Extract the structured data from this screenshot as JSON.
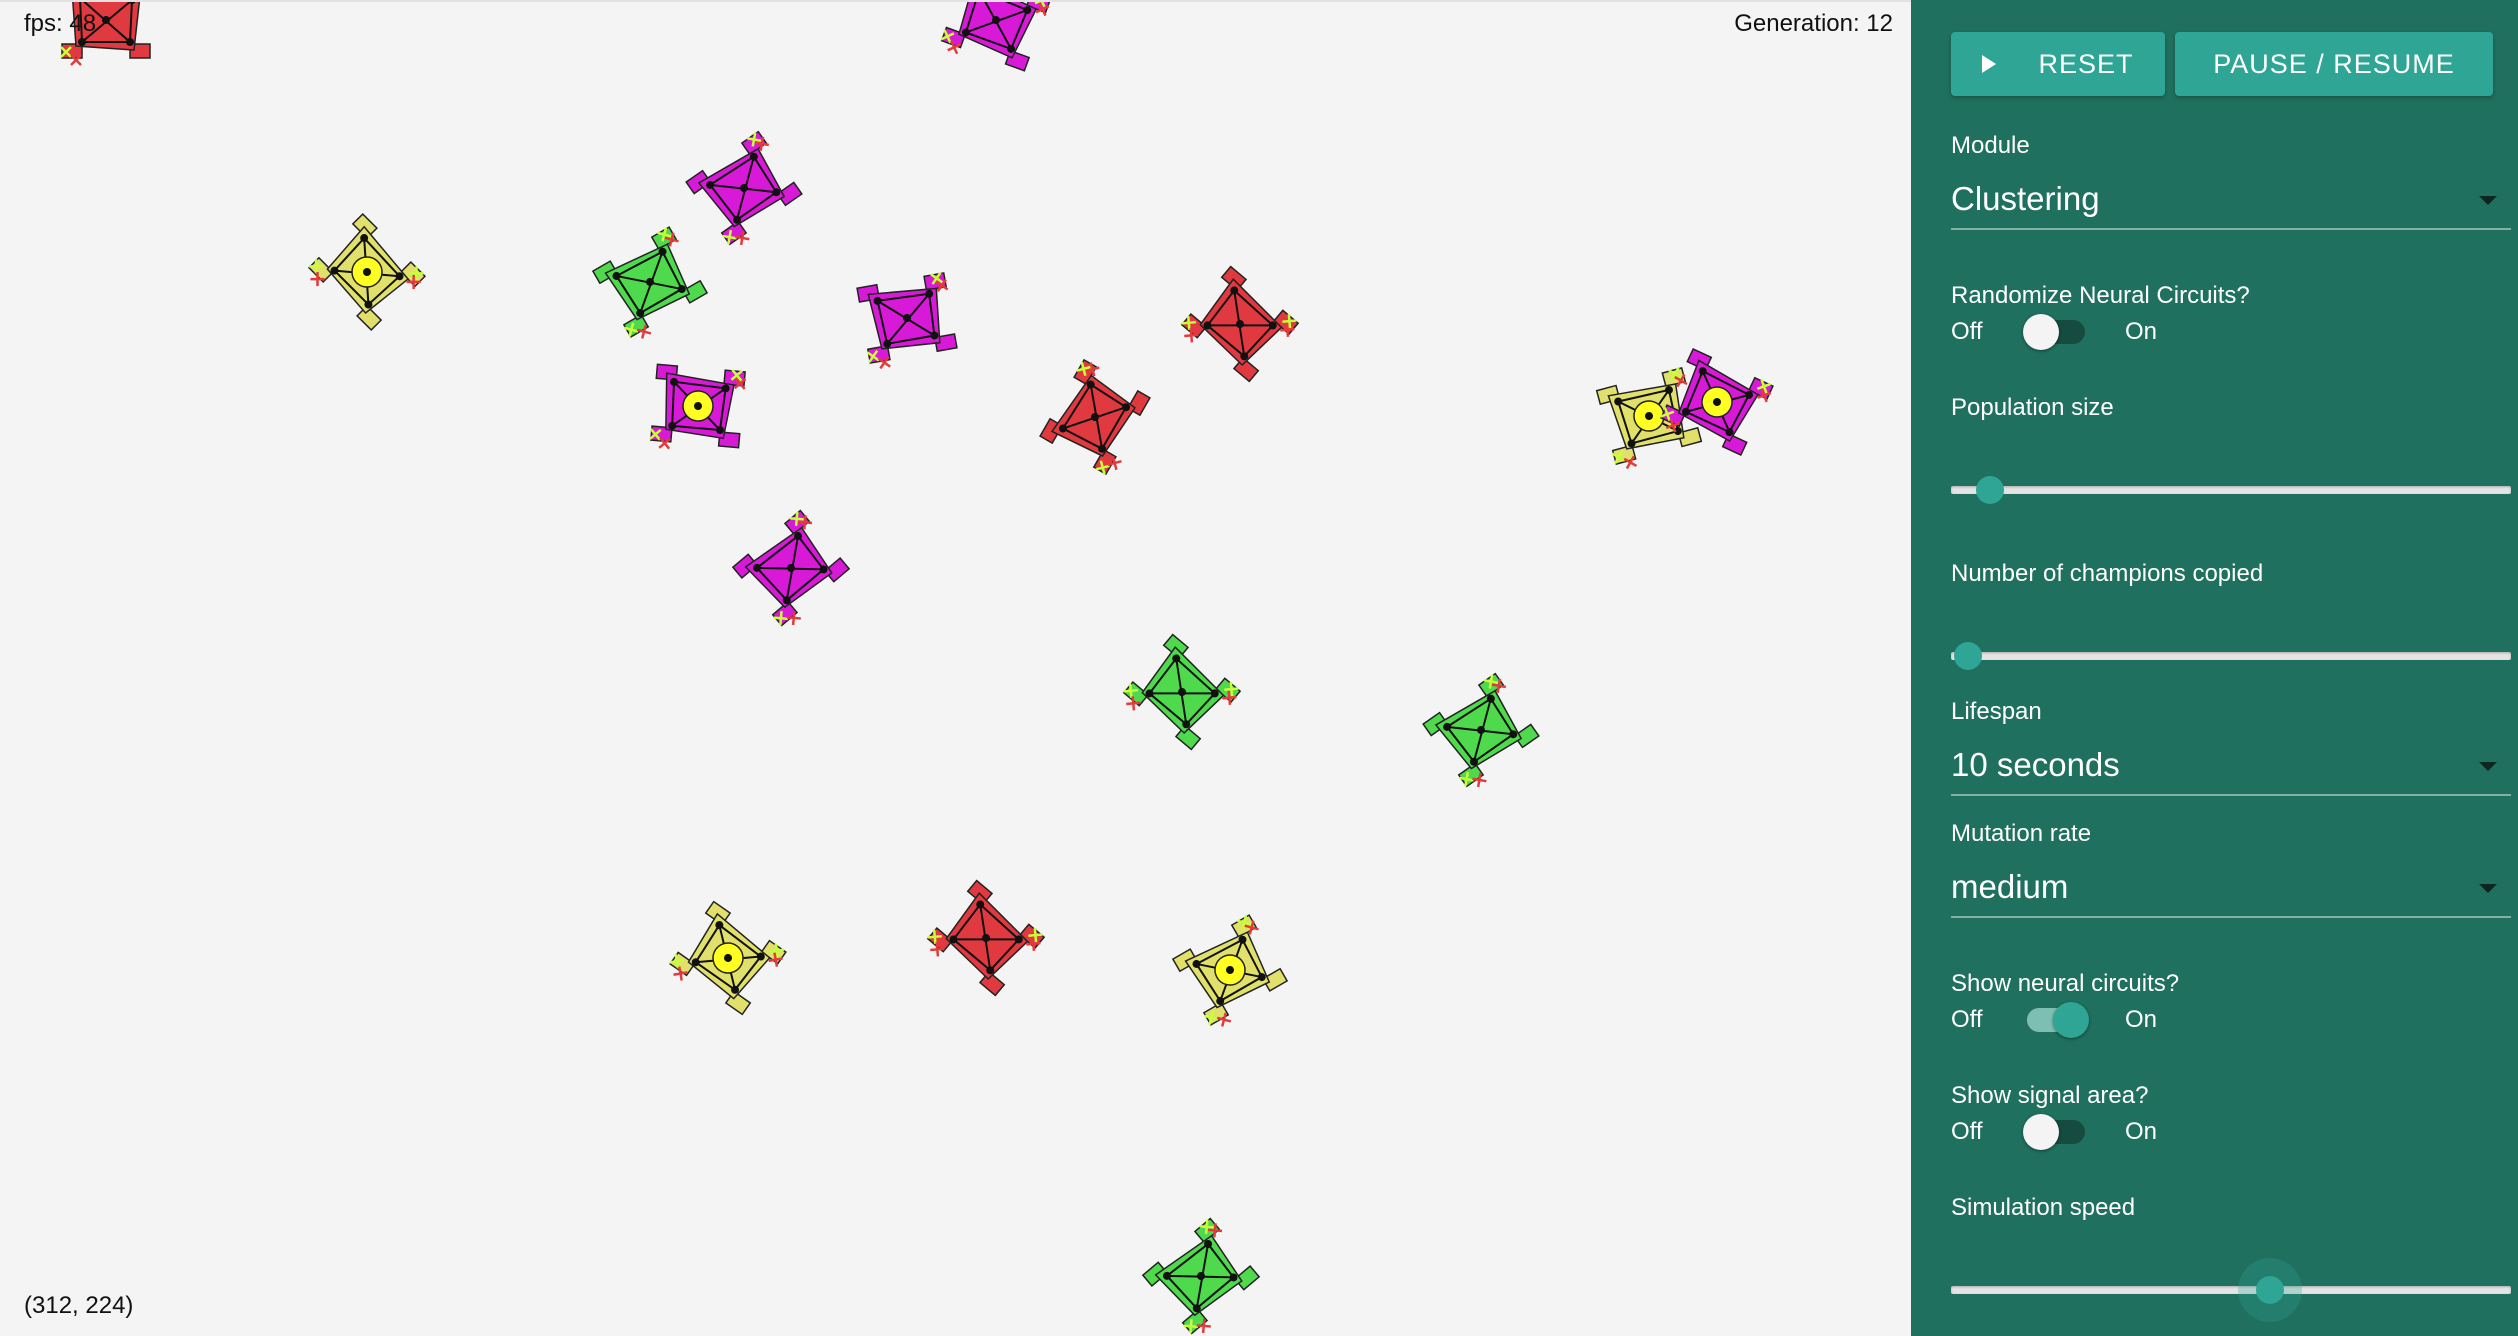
{
  "hud": {
    "fps": "fps: 48",
    "generation": "Generation: 12",
    "coords": "(312, 224)"
  },
  "controls": {
    "reset_label": "RESET",
    "pause_label": "PAUSE / RESUME",
    "module": {
      "label": "Module",
      "value": "Clustering"
    },
    "randomize": {
      "label": "Randomize Neural Circuits?",
      "off": "Off",
      "on": "On",
      "checked": false
    },
    "population": {
      "label": "Population size",
      "value_fraction": 0.07
    },
    "champions": {
      "label": "Number of champions copied",
      "value_fraction": 0.03
    },
    "lifespan": {
      "label": "Lifespan",
      "value": "10 seconds"
    },
    "mutation": {
      "label": "Mutation rate",
      "value": "medium"
    },
    "show_circuits": {
      "label": "Show neural circuits?",
      "off": "Off",
      "on": "On",
      "checked": true
    },
    "show_signal": {
      "label": "Show signal area?",
      "off": "Off",
      "on": "On",
      "checked": false
    },
    "speed": {
      "label": "Simulation speed",
      "value_fraction": 0.57
    }
  },
  "colors": {
    "panel": "#20705f",
    "accent": "#2ea595",
    "red": "#e0393f",
    "magenta": "#d81ad8",
    "green": "#4fd94c",
    "yellow": "#e0e06a"
  },
  "creatures": [
    {
      "color": "red",
      "rot": 0,
      "signal": false
    },
    {
      "color": "magenta",
      "rot": 20,
      "signal": false
    },
    {
      "color": "magenta",
      "rot": -35,
      "signal": false
    },
    {
      "color": "yellow",
      "rot": 45,
      "signal": true
    },
    {
      "color": "green",
      "rot": -30,
      "signal": false
    },
    {
      "color": "magenta",
      "rot": -10,
      "signal": false
    },
    {
      "color": "magenta",
      "rot": 5,
      "signal": true
    },
    {
      "color": "red",
      "rot": 40,
      "signal": false
    },
    {
      "color": "red",
      "rot": -60,
      "signal": false
    },
    {
      "color": "yellow",
      "rot": -15,
      "signal": true
    },
    {
      "color": "magenta",
      "rot": 25,
      "signal": true
    },
    {
      "color": "magenta",
      "rot": -40,
      "signal": false
    },
    {
      "color": "green",
      "rot": 40,
      "signal": false
    },
    {
      "color": "green",
      "rot": -35,
      "signal": false
    },
    {
      "color": "yellow",
      "rot": 35,
      "signal": true
    },
    {
      "color": "red",
      "rot": 40,
      "signal": false
    },
    {
      "color": "yellow",
      "rot": -30,
      "signal": true
    },
    {
      "color": "green",
      "rot": -40,
      "signal": false
    }
  ]
}
